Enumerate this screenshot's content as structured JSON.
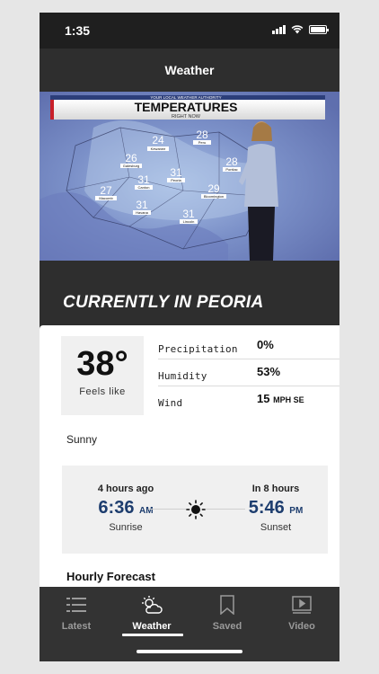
{
  "status_bar": {
    "time": "1:35"
  },
  "header": {
    "title": "Weather"
  },
  "video": {
    "banner_top": "YOUR LOCAL WEATHER AUTHORITY",
    "banner_title": "TEMPERATURES",
    "banner_subtitle": "RIGHT NOW",
    "map_labels": [
      {
        "temp": "24",
        "city": "Kewanee"
      },
      {
        "temp": "28",
        "city": "Peru"
      },
      {
        "temp": "26",
        "city": "Galesburg"
      },
      {
        "temp": "31",
        "city": "Peoria"
      },
      {
        "temp": "28",
        "city": "Pontiac"
      },
      {
        "temp": "27",
        "city": "Macomb"
      },
      {
        "temp": "31",
        "city": "Canton"
      },
      {
        "temp": "29",
        "city": "Bloomington"
      },
      {
        "temp": "31",
        "city": "Havana"
      },
      {
        "temp": "31",
        "city": "Lincoln"
      }
    ]
  },
  "section": {
    "heading": "CURRENTLY IN PEORIA"
  },
  "current": {
    "temp": "38°",
    "feels_like_label": "Feels like",
    "stats": [
      {
        "label": "Precipitation",
        "value": "0%",
        "unit": ""
      },
      {
        "label": "Humidity",
        "value": "53%",
        "unit": ""
      },
      {
        "label": "Wind",
        "value": "15",
        "unit": "MPH SE"
      }
    ],
    "condition": "Sunny"
  },
  "sun": {
    "sunrise_rel": "4 hours ago",
    "sunrise_time": "6:36",
    "sunrise_ampm": "AM",
    "sunrise_label": "Sunrise",
    "sunset_rel": "In 8 hours",
    "sunset_time": "5:46",
    "sunset_ampm": "PM",
    "sunset_label": "Sunset",
    "icon": "sun-icon"
  },
  "hourly": {
    "title": "Hourly Forecast"
  },
  "tabs": [
    {
      "label": "Latest",
      "icon": "list-icon",
      "active": false
    },
    {
      "label": "Weather",
      "icon": "weather-icon",
      "active": true
    },
    {
      "label": "Saved",
      "icon": "bookmark-icon",
      "active": false
    },
    {
      "label": "Video",
      "icon": "play-icon",
      "active": false
    }
  ],
  "colors": {
    "accent_blue": "#1d3d6e",
    "banner_red": "#c8202a"
  }
}
